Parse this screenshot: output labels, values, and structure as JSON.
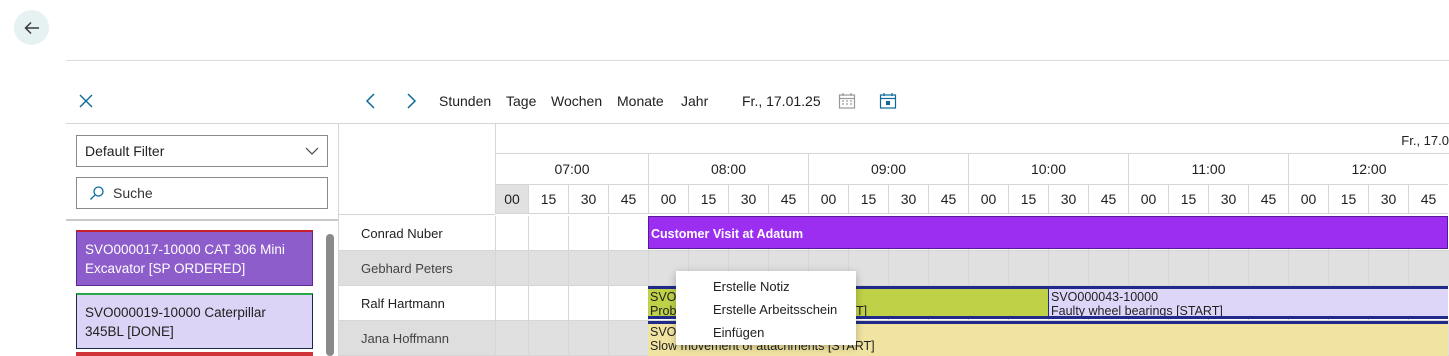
{
  "page": {
    "back_icon": "arrow-left-icon",
    "close_icon": "close-icon"
  },
  "toolbar": {
    "prev_icon": "chevron-left-icon",
    "next_icon": "chevron-right-icon",
    "views": [
      "Stunden",
      "Tage",
      "Wochen",
      "Monate",
      "Jahr"
    ],
    "date": "Fr., 17.01.25",
    "calendar_icon": "calendar-icon",
    "today_icon": "calendar-today-icon"
  },
  "left_pane": {
    "filter_value": "Default Filter",
    "search_placeholder": "Suche",
    "tasks": [
      {
        "label": "SVO000017-10000 CAT 306 Mini Excavator [SP ORDERED]",
        "color": "#8d5dcb",
        "status_color": "#c8202a"
      },
      {
        "label": "SVO000019-10000 Caterpillar 345BL [DONE]",
        "color": "#dcd4f6",
        "status_color": "#2aa64b"
      }
    ]
  },
  "gantt": {
    "date_header": "Fr., 17.0",
    "hours": [
      "07:00",
      "08:00",
      "09:00",
      "10:00",
      "11:00",
      "12:00"
    ],
    "minutes": [
      "00",
      "15",
      "30",
      "45",
      "00",
      "15",
      "30",
      "45",
      "00",
      "15",
      "30",
      "45",
      "00",
      "15",
      "30",
      "45",
      "00",
      "15",
      "30",
      "45",
      "00",
      "15",
      "30",
      "45"
    ],
    "resources": [
      "Conrad Nuber",
      "Gebhard Peters",
      "Ralf Hartmann",
      "Jana Hoffmann"
    ],
    "bars": [
      {
        "line1": "Customer Visit at Adatum",
        "line2": ""
      },
      {
        "line1": "SVO",
        "line2": "Prob",
        "tail": "T]"
      },
      {
        "line1": "SVO000043-10000",
        "line2": "Faulty wheel bearings [START]"
      },
      {
        "line1": "SVO",
        "line2": "Slow movement of attachments [START]"
      }
    ]
  },
  "context_menu": {
    "items": [
      "Erstelle Notiz",
      "Erstelle Arbeitsschein",
      "Einfügen"
    ]
  }
}
